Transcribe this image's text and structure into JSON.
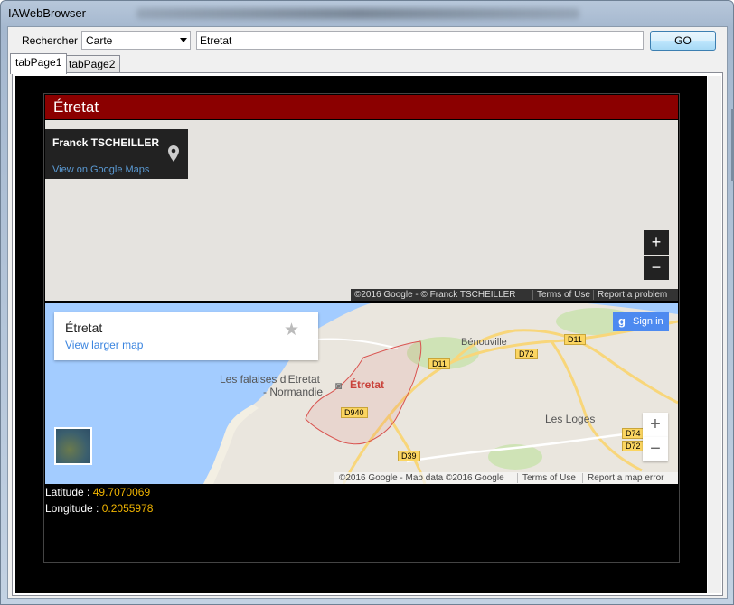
{
  "window": {
    "title": "IAWebBrowser"
  },
  "toolbar": {
    "search_label": "Rechercher",
    "mode_selected": "Carte",
    "url_value": "Etretat",
    "go_label": "GO"
  },
  "tabs": [
    {
      "label": "tabPage1",
      "active": true
    },
    {
      "label": "tabPage2",
      "active": false
    }
  ],
  "page": {
    "header": "Étretat",
    "map1": {
      "owner": "Franck TSCHEILLER",
      "view_link": "View on Google Maps",
      "zoom_in": "+",
      "zoom_out": "−",
      "footer": {
        "copyright": "©2016 Google - © Franck TSCHEILLER",
        "terms": "Terms of Use",
        "report": "Report a problem"
      }
    },
    "map2": {
      "place_title": "Étretat",
      "larger_map_link": "View larger map",
      "sign_in": "Sign in",
      "zoom_in": "+",
      "zoom_out": "−",
      "labels": {
        "benouville": "Bénouville",
        "falaises_1": "Les falaises d'Etretat",
        "falaises_2": "- Normandie",
        "etretat": "Étretat",
        "les_loges": "Les Loges"
      },
      "roads": [
        "D11",
        "D72",
        "D11",
        "D940",
        "D39",
        "D74",
        "D72"
      ],
      "footer": {
        "copyright": "©2016 Google - Map data ©2016 Google",
        "terms": "Terms of Use",
        "report": "Report a map error"
      }
    },
    "latitude": {
      "label": "Latitude : ",
      "value": "49.7070069"
    },
    "longitude": {
      "label": "Longitude : ",
      "value": "0.2055978"
    }
  },
  "colors": {
    "header_bg": "#8b0000",
    "coord_value": "#f0b400",
    "sea": "#a3ccff",
    "land": "#eae6de",
    "commune_border": "#d9534f"
  },
  "icons": {
    "map_pin": "map-pin-icon",
    "star": "star-icon",
    "google_g": "google-g-icon"
  }
}
